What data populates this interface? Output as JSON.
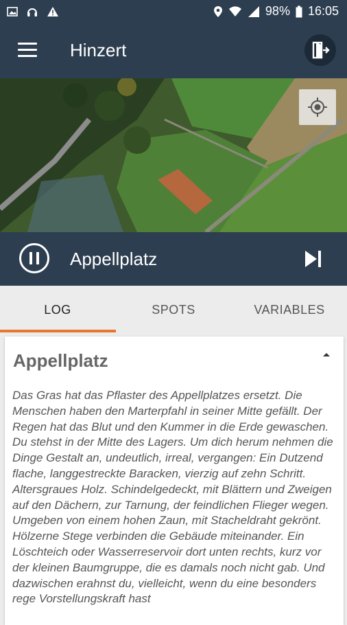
{
  "status_bar": {
    "battery": "98%",
    "time": "16:05",
    "left_icons": [
      "image-icon",
      "headset-icon",
      "warning-icon"
    ],
    "right_icons": [
      "location-icon",
      "wifi-icon",
      "signal-icon",
      "battery-icon"
    ]
  },
  "toolbar": {
    "title": "Hinzert",
    "menu_icon": "hamburger-menu-icon",
    "exit_icon": "exit-icon"
  },
  "map": {
    "locate_icon": "gps-locate-icon"
  },
  "player": {
    "title": "Appellplatz",
    "pause_icon": "pause-icon",
    "skip_icon": "skip-next-icon"
  },
  "tabs": [
    "LOG",
    "SPOTS",
    "VARIABLES"
  ],
  "card": {
    "title": "Appellplatz",
    "text": "Das Gras hat das Pflaster des Appellplatzes ersetzt. Die Menschen haben den Marterpfahl in seiner Mitte gefällt. Der Regen hat das Blut und den Kummer in die Erde gewaschen. Du stehst in der Mitte des Lagers. Um dich herum nehmen die Dinge Gestalt an, undeutlich, irreal, vergangen: Ein Dutzend flache, langgestreckte Baracken, vierzig auf zehn Schritt. Altersgraues Holz. Schindelgedeckt, mit Blättern und Zweigen auf den Dächern, zur Tarnung, der feindlichen Flieger wegen. Umgeben von einem hohen Zaun, mit Stacheldraht gekrönt. Hölzerne Stege verbinden die Gebäude miteinander. Ein Löschteich oder Wasserreservoir dort unten rechts, kurz vor der kleinen Baumgruppe, die es damals noch nicht gab. Und dazwischen erahnst du, vielleicht, wenn du eine besonders rege Vorstellungskraft hast"
  },
  "colors": {
    "header": "#2d3e50",
    "accent": "#e8762c"
  }
}
